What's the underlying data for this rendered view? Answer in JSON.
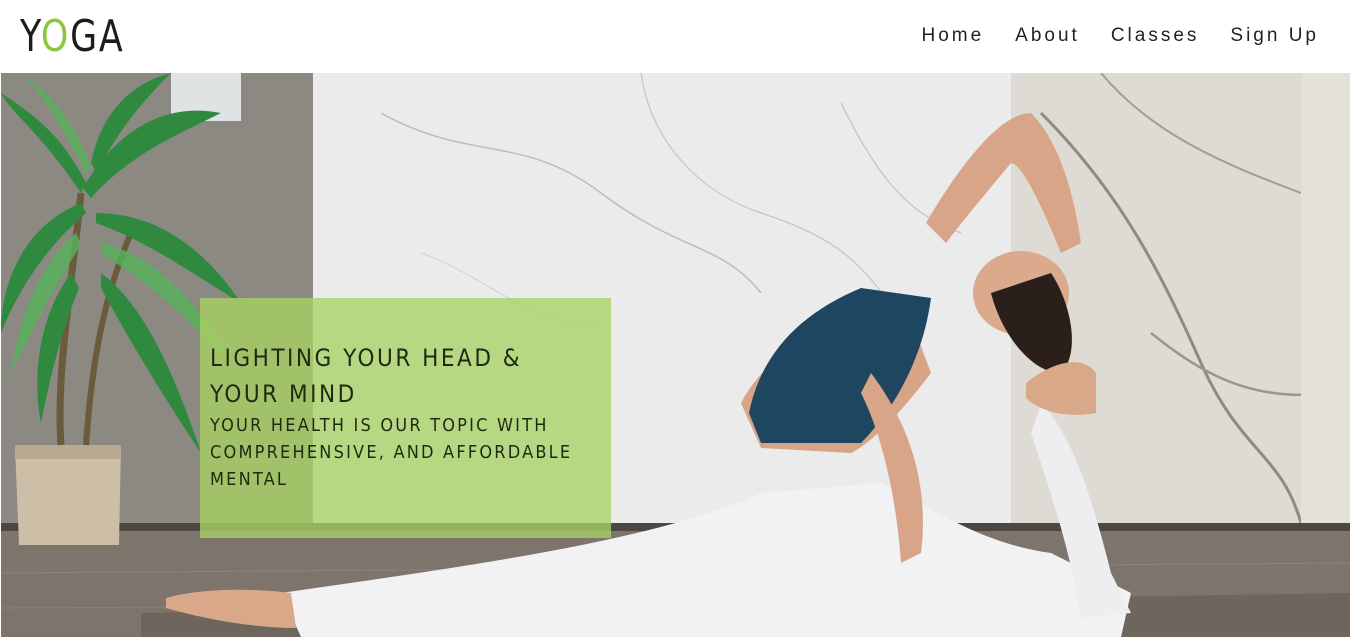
{
  "header": {
    "logo": {
      "part1": "Y",
      "part2": "O",
      "part3": "GA"
    },
    "nav": [
      {
        "label": "Home"
      },
      {
        "label": "About"
      },
      {
        "label": "Classes"
      },
      {
        "label": "Sign Up"
      }
    ]
  },
  "hero": {
    "heading": "LIGHTING YOUR HEAD & YOUR MIND",
    "subheading": "YOUR HEALTH IS OUR TOPIC WITH COMPREHENSIVE, AND AFFORDABLE MENTAL"
  },
  "colors": {
    "accent": "#8cc63f",
    "overlay": "#a8d264",
    "text_dark": "#1c1c1c"
  }
}
